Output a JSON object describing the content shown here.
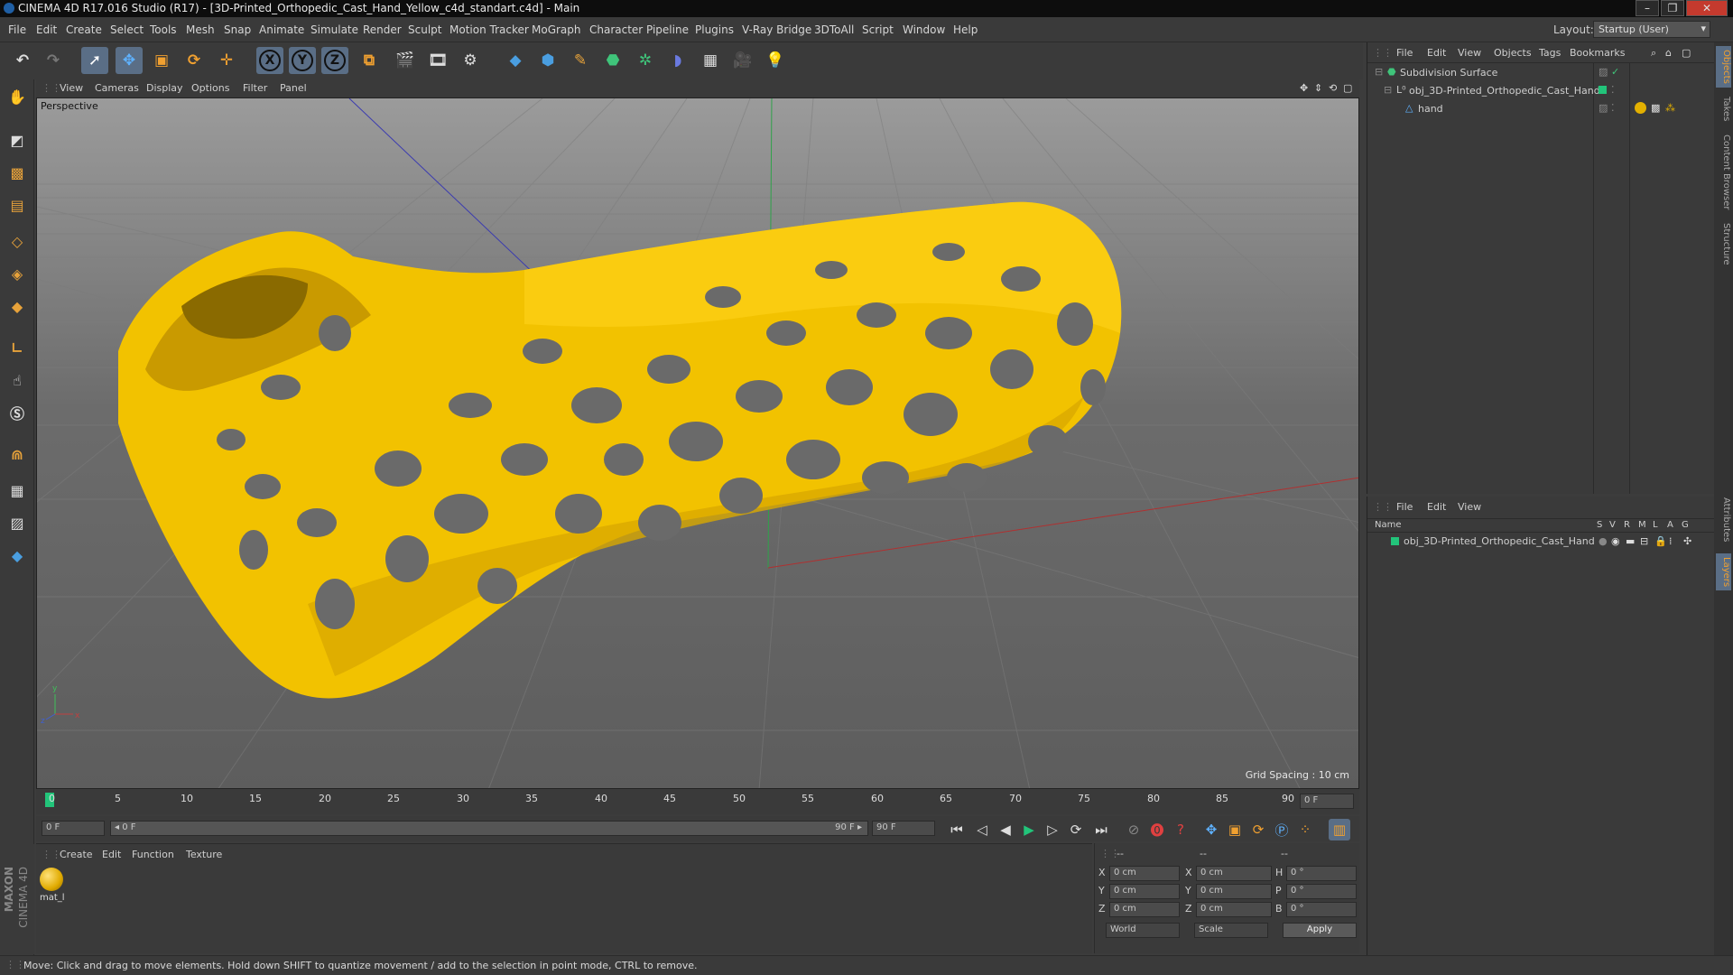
{
  "window": {
    "title": "CINEMA 4D R17.016 Studio (R17) - [3D-Printed_Orthopedic_Cast_Hand_Yellow_c4d_standart.c4d] - Main"
  },
  "menu": [
    "File",
    "Edit",
    "Create",
    "Select",
    "Tools",
    "Mesh",
    "Snap",
    "Animate",
    "Simulate",
    "Render",
    "Sculpt",
    "Motion Tracker",
    "MoGraph",
    "Character",
    "Pipeline",
    "Plugins",
    "V-Ray Bridge",
    "3DToAll",
    "Script",
    "Window",
    "Help"
  ],
  "layout": {
    "label": "Layout:",
    "value": "Startup (User)"
  },
  "toolbar_axes": [
    "X",
    "Y",
    "Z"
  ],
  "viewport": {
    "menu": [
      "View",
      "Cameras",
      "Display",
      "Options",
      "Filter",
      "Panel"
    ],
    "camera_label": "Perspective",
    "grid_spacing": "Grid Spacing : 10 cm",
    "axis_y": "y",
    "axis_z": "z",
    "axis_x": "x"
  },
  "timeline": {
    "ticks": [
      "0",
      "5",
      "10",
      "15",
      "20",
      "25",
      "30",
      "35",
      "40",
      "45",
      "50",
      "55",
      "60",
      "65",
      "70",
      "75",
      "80",
      "85",
      "90"
    ],
    "current_frame": "0 F",
    "start_frame": "0 F",
    "range_start": "◂ 0 F",
    "range_end": "90 F ▸",
    "end_frame": "90 F"
  },
  "material_manager": {
    "menu": [
      "Create",
      "Edit",
      "Function",
      "Texture"
    ],
    "material_name": "mat_l",
    "brand_top": "MAXON",
    "brand_bottom": "CINEMA 4D"
  },
  "coordinates": {
    "header": [
      "--",
      "--",
      "--"
    ],
    "rows": [
      {
        "a": "X",
        "av": "0 cm",
        "b": "X",
        "bv": "0 cm",
        "c": "H",
        "cv": "0 °"
      },
      {
        "a": "Y",
        "av": "0 cm",
        "b": "Y",
        "bv": "0 cm",
        "c": "P",
        "cv": "0 °"
      },
      {
        "a": "Z",
        "av": "0 cm",
        "b": "Z",
        "bv": "0 cm",
        "c": "B",
        "cv": "0 °"
      }
    ],
    "mode1": "World",
    "mode2": "Scale",
    "apply": "Apply"
  },
  "object_manager": {
    "menu": [
      "File",
      "Edit",
      "View",
      "Objects",
      "Tags",
      "Bookmarks"
    ],
    "objects": [
      {
        "name": "Subdivision Surface"
      },
      {
        "name": "obj_3D-Printed_Orthopedic_Cast_Hand"
      },
      {
        "name": "hand"
      }
    ]
  },
  "layer_manager": {
    "menu": [
      "File",
      "Edit",
      "View"
    ],
    "columns": [
      "Name",
      "S",
      "V",
      "R",
      "M",
      "L",
      "A",
      "G"
    ],
    "layers": [
      {
        "name": "obj_3D-Printed_Orthopedic_Cast_Hand"
      }
    ]
  },
  "side_tabs": [
    "Objects",
    "Takes",
    "Content Browser",
    "Structure",
    "Attributes",
    "Layers"
  ],
  "status": "Move: Click and drag to move elements. Hold down SHIFT to quantize movement / add to the selection in point mode, CTRL to remove.",
  "colors": {
    "cast": "#f2c200",
    "accent": "#5a6e86",
    "green": "#22c47a"
  }
}
